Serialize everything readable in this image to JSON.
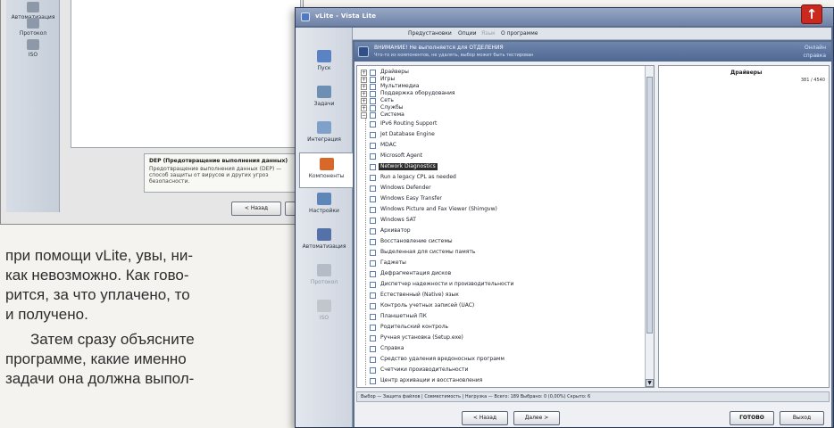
{
  "background_window": {
    "sidebar_items": [
      {
        "label": "Автоматизация",
        "icon": "auto-icon"
      },
      {
        "label": "Протокол",
        "icon": "log-icon"
      },
      {
        "label": "ISO",
        "icon": "iso-icon"
      }
    ],
    "info_title": "DEP (Предотвращение выполнения данных)",
    "info_body": "Предотвращение выполнения данных (DEP) — способ защиты от вирусов и других угроз безопасности.",
    "buttons": {
      "back": "< Назад",
      "next": ""
    }
  },
  "article": {
    "lines": [
      "при помощи vLite, увы, ни-",
      "как невозможно. Как гово-",
      "рится, за что уплачено, то",
      "и получено."
    ],
    "paragraph2": [
      "Затем сразу объясните",
      "программе, какие именно",
      "задачи она должна выпол-"
    ]
  },
  "window": {
    "title": "vLite - Vista Lite",
    "close_icon": "up-arrow-icon",
    "colors": {
      "frame": "#5c6e8e",
      "banner": "#4f6892",
      "close": "#c9291e",
      "selection": "#2b2b2b"
    },
    "menu": [
      "Предустановки",
      "Опции",
      "Язык",
      "О программе"
    ],
    "sidebar": [
      {
        "label": "Пуск",
        "icon": "time-icon"
      },
      {
        "label": "Задачи",
        "icon": "tasks-icon"
      },
      {
        "label": "Интеграция",
        "icon": "integration-icon"
      },
      {
        "label": "Компоненты",
        "icon": "remove-icon"
      },
      {
        "label": "Настройки",
        "icon": "tweaks-icon"
      },
      {
        "label": "Автоматизация",
        "icon": "auto-icon"
      },
      {
        "label": "Протокол",
        "icon": "log-icon"
      },
      {
        "label": "ISO",
        "icon": "iso-icon"
      }
    ],
    "banner": {
      "line1": "ВНИМАНИЕ! Не выполняется для ОТДЕЛЕНИЯ",
      "line2": "Что-то из компонентов, не удалять, выбор может быть тестирован",
      "link1": "Онлайн",
      "link2": "справка"
    },
    "tree": {
      "top_groups": [
        "Драйверы",
        "Игры",
        "Мультимедиа",
        "Поддержка оборудования",
        "Сеть",
        "Службы",
        "Система"
      ],
      "system_items": [
        "IPv6 Routing Support",
        "Jet Database Engine",
        "MDAC",
        "Microsoft Agent",
        "Network Diagnostics",
        "Run a legacy CPL as needed",
        "Windows Defender",
        "Windows Easy Transfer",
        "Windows Picture and Fax Viewer (Shimgvw)",
        "Windows SAT",
        "Архиватор",
        "Восстановление системы",
        "Выделенная для системы память",
        "Гаджеты",
        "Дефрагментация дисков",
        "Диспетчер надежности и производительности",
        "Естественный (Native) язык",
        "Контроль учетных записей (UAC)",
        "Планшетный ПК",
        "Родительский контроль",
        "Ручная установка (Setup.exe)",
        "Справка",
        "Средство удаления вредоносных программ",
        "Счетчики производительности",
        "Центр архивации и восстановления"
      ],
      "selected_item": "Network Diagnostics"
    },
    "info_panel": {
      "heading": "Драйверы",
      "value": "381 / 4540"
    },
    "status": "Выбор — Защита файлов | Совместимость | Нагрузка — Всего: 189 Выбрано: 0 (0,00%) Скрыто: 6",
    "buttons": {
      "back": "< Назад",
      "next": "Далее >",
      "done": "ГОТОВО",
      "exit": "Выход"
    }
  }
}
